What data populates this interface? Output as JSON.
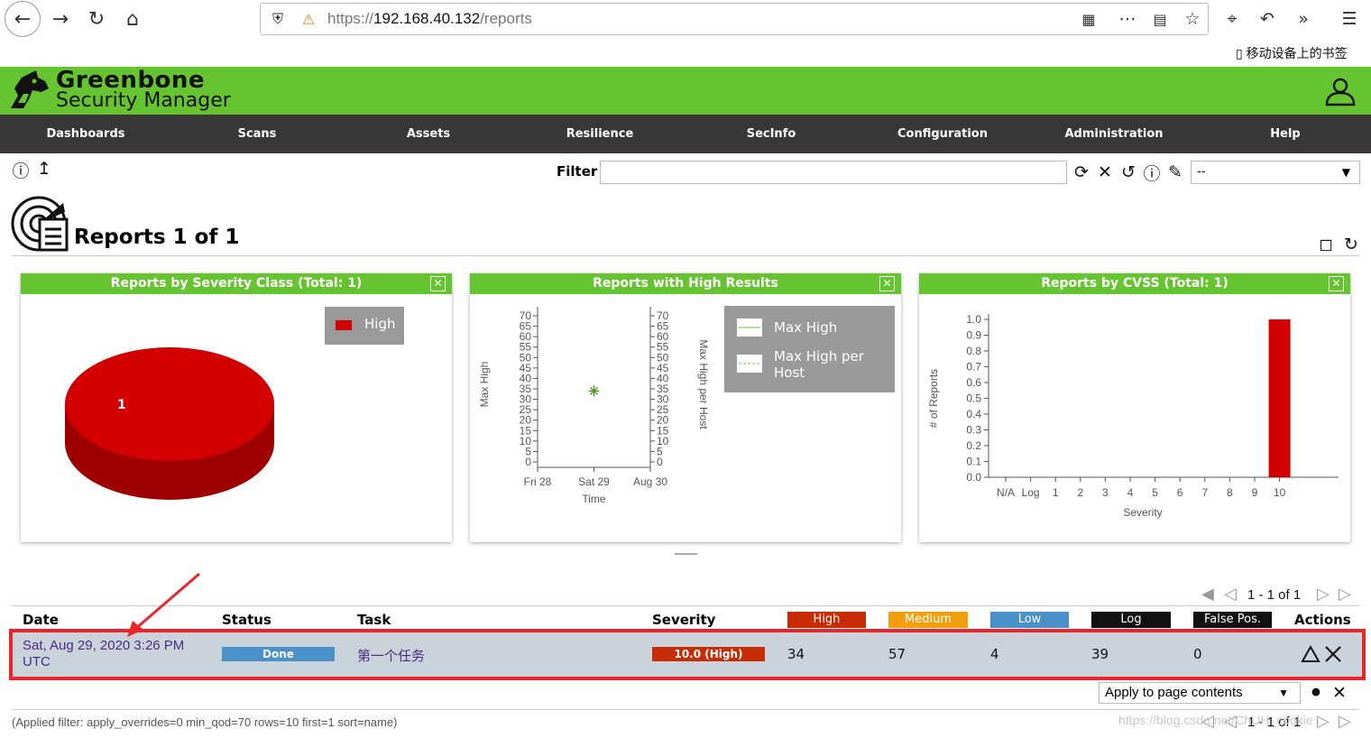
{
  "browser": {
    "url_prefix": "https://",
    "url_host": "192.168.40.132",
    "url_path": "/reports",
    "mobile_bookmarks": "移动设备上的书签"
  },
  "header": {
    "brand_line1": "Greenbone",
    "brand_line2": "Security Manager"
  },
  "menu": [
    "Dashboards",
    "Scans",
    "Assets",
    "Resilience",
    "SecInfo",
    "Configuration",
    "Administration",
    "Help"
  ],
  "toolbar": {
    "filter_label": "Filter",
    "filter_value": "",
    "filter_select": "--"
  },
  "page": {
    "title": "Reports 1 of 1"
  },
  "panels": {
    "severity_class": {
      "title": "Reports by Severity Class (Total: 1)",
      "legend": "High",
      "pie_label": "1"
    },
    "high_results": {
      "title": "Reports with High Results",
      "legend": [
        "Max High",
        "Max High per Host"
      ]
    },
    "cvss": {
      "title": "Reports by CVSS (Total: 1)"
    }
  },
  "chart_data": [
    {
      "type": "pie",
      "categories": [
        "High"
      ],
      "values": [
        1
      ],
      "colors": [
        "#d20000"
      ]
    },
    {
      "type": "scatter",
      "xlabel": "Time",
      "ylabel": "Max High",
      "ylabel_right": "Max High per Host",
      "categories": [
        "Fri 28",
        "Sat 29",
        "Aug 30"
      ],
      "yticks": [
        "0",
        "5",
        "10",
        "15",
        "20",
        "25",
        "30",
        "35",
        "40",
        "45",
        "50",
        "55",
        "60",
        "65",
        "70"
      ],
      "ylim": [
        0,
        70
      ],
      "series": [
        {
          "name": "Max High",
          "x": [
            "Sat 29"
          ],
          "values": [
            34
          ]
        }
      ]
    },
    {
      "type": "bar",
      "xlabel": "Severity",
      "ylabel": "# of Reports",
      "categories": [
        "N/A",
        "Log",
        "1",
        "2",
        "3",
        "4",
        "5",
        "6",
        "7",
        "8",
        "9",
        "10"
      ],
      "values": [
        0,
        0,
        0,
        0,
        0,
        0,
        0,
        0,
        0,
        0,
        0,
        1
      ],
      "yticks": [
        "0.0",
        "0.1",
        "0.2",
        "0.3",
        "0.4",
        "0.5",
        "0.6",
        "0.7",
        "0.8",
        "0.9",
        "1.0"
      ],
      "ylim": [
        0,
        1.0
      ]
    }
  ],
  "table": {
    "pager_text": "1 - 1 of 1",
    "headers": {
      "date": "Date",
      "status": "Status",
      "task": "Task",
      "severity": "Severity",
      "high": "High",
      "medium": "Medium",
      "low": "Low",
      "log": "Log",
      "false_pos": "False Pos.",
      "actions": "Actions"
    },
    "header_colors": {
      "high": "#c82c06",
      "medium": "#f0a00e",
      "low": "#4a90c9",
      "log": "#111111",
      "false_pos": "#111111"
    },
    "rows": [
      {
        "date": "Sat, Aug 29, 2020 3:26 PM UTC",
        "status": "Done",
        "task": "第一个任务",
        "severity": "10.0 (High)",
        "high": "34",
        "medium": "57",
        "low": "4",
        "log": "39",
        "false_pos": "0"
      }
    ],
    "apply_select": "Apply to page contents",
    "applied_filter": "(Applied filter: apply_overrides=0 min_qod=70 rows=10 first=1 sort=name)"
  },
  "watermark": "https://blog.csdn.net/ChUH_cookie"
}
